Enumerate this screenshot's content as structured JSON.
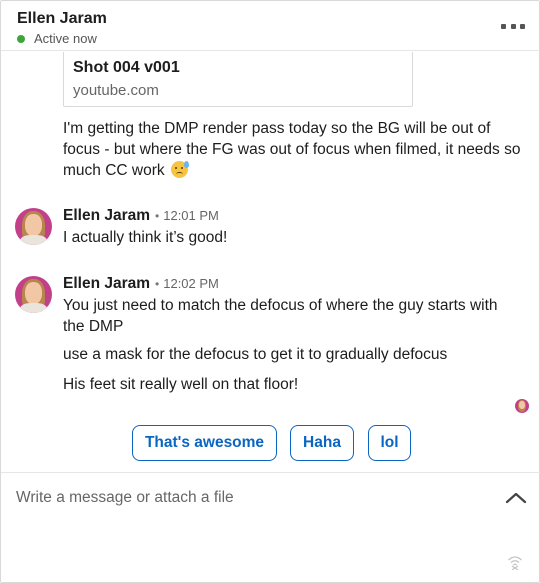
{
  "header": {
    "name": "Ellen Jaram",
    "status": "Active now",
    "status_color": "#3da63b"
  },
  "link_preview": {
    "title": "Shot 004 v001",
    "domain": "youtube.com"
  },
  "messages": [
    {
      "text": "I'm getting the DMP render pass today so the BG will be out of focus - but where the FG was out of focus when filmed, it needs so much CC work",
      "emoji": "anxious-sweat-face"
    },
    {
      "sender": "Ellen Jaram",
      "separator": "•",
      "time": "12:01 PM",
      "lines": [
        "I actually think it’s good!"
      ]
    },
    {
      "sender": "Ellen Jaram",
      "separator": "•",
      "time": "12:02 PM",
      "lines": [
        "You just need to match the defocus of where the guy starts with the DMP",
        "use a mask for the defocus to get it to gradually defocus",
        "His feet sit really well on that floor!"
      ]
    }
  ],
  "quick_replies": [
    "That's awesome",
    "Haha",
    "lol"
  ],
  "composer": {
    "placeholder": "Write a message or attach a file"
  },
  "colors": {
    "accent": "#0a66c2",
    "avatar_bg": "#c2408a"
  }
}
